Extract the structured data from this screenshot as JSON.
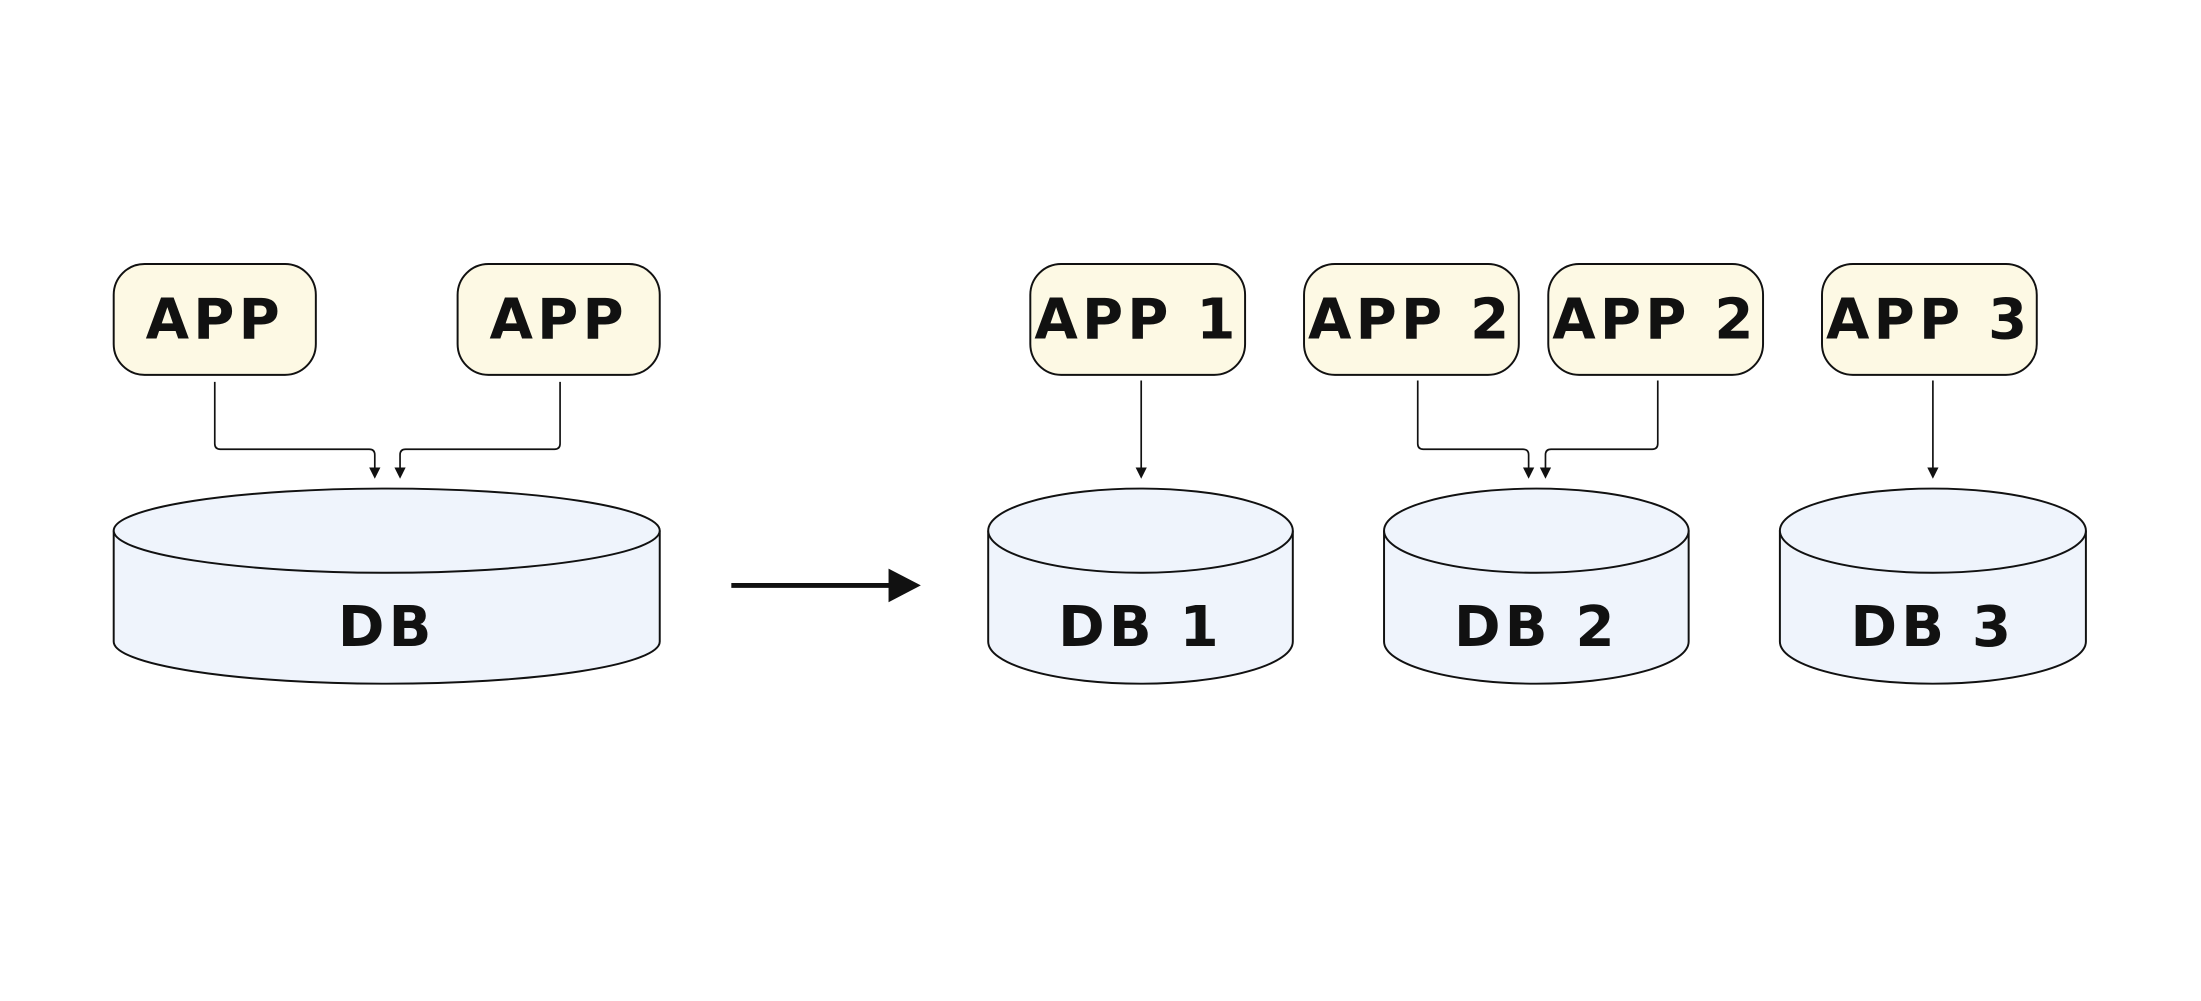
{
  "before": {
    "apps": [
      "APP",
      "APP"
    ],
    "db": "DB"
  },
  "after": {
    "apps": [
      "APP 1",
      "APP 2",
      "APP 2",
      "APP 3"
    ],
    "dbs": [
      "DB 1",
      "DB 2",
      "DB 3"
    ]
  },
  "colors": {
    "app_fill": "#fdf9e4",
    "db_fill": "#eff4fc",
    "stroke": "#111111"
  }
}
